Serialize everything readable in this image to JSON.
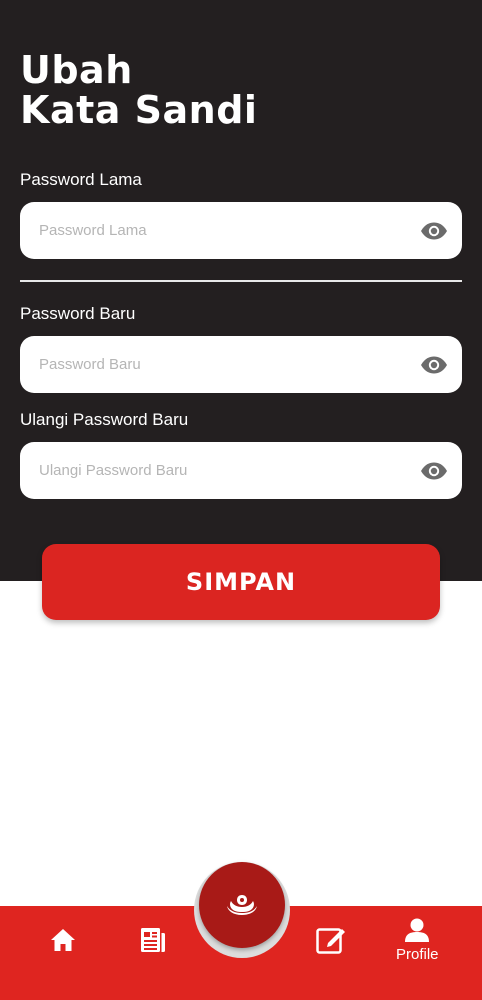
{
  "header": {
    "title_line1": "Ubah",
    "title_line2": "Kata Sandi"
  },
  "form": {
    "old_password": {
      "label": "Password Lama",
      "placeholder": "Password Lama",
      "value": ""
    },
    "new_password": {
      "label": "Password Baru",
      "placeholder": "Password Baru",
      "value": ""
    },
    "confirm_password": {
      "label": "Ulangi Password Baru",
      "placeholder": "Ulangi Password Baru",
      "value": ""
    },
    "submit_label": "SIMPAN"
  },
  "bottom_nav": {
    "items": [
      {
        "id": "home",
        "icon": "home-icon",
        "label": ""
      },
      {
        "id": "news",
        "icon": "newspaper-icon",
        "label": ""
      },
      {
        "id": "center",
        "icon": "logo-emblem-icon",
        "label": ""
      },
      {
        "id": "edit",
        "icon": "edit-icon",
        "label": ""
      },
      {
        "id": "profile",
        "icon": "user-icon",
        "label": "Profile"
      }
    ]
  },
  "colors": {
    "panel_dark": "#231f20",
    "accent_red": "#db2521",
    "fab_dark_red": "#a81a17",
    "input_bg": "#ffffff",
    "icon_gray": "#6b6b6b"
  }
}
